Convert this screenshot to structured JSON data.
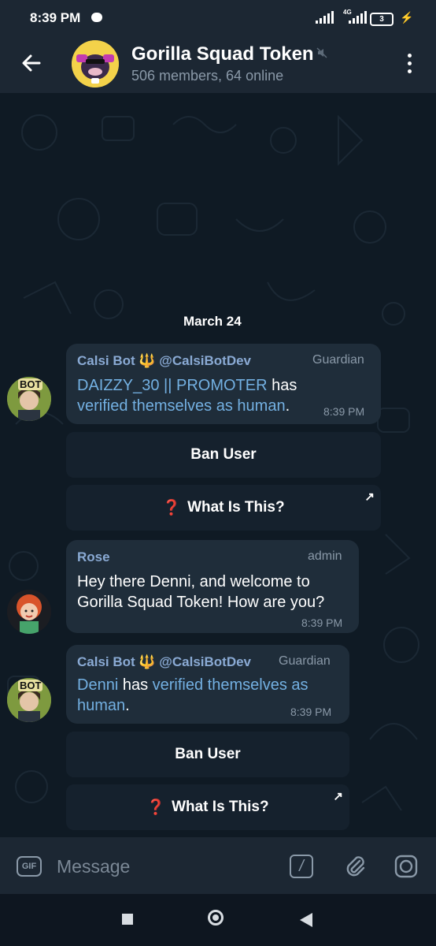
{
  "status_bar": {
    "time": "8:39 PM",
    "network": "4G",
    "battery": "3"
  },
  "header": {
    "title": "Gorilla Squad Token",
    "subtitle": "506 members, 64 online"
  },
  "date_separator": "March 24",
  "messages": [
    {
      "sender": "Calsi Bot 🔱 @CalsiBotDev",
      "tag": "Guardian",
      "user_link": "DAIZZY_30 || PROMOTER",
      "word_has": "has",
      "verified_text": "verified themselves as human",
      "period": ".",
      "time": "8:39 PM",
      "avatar_label": "BOT",
      "buttons": {
        "ban": "Ban User",
        "what_icon": "❓",
        "what": "What Is This?",
        "arrow": "↗"
      }
    },
    {
      "sender": "Rose",
      "tag": "admin",
      "text_line1": "Hey there Denni, and welcome to",
      "text_line2": "Gorilla Squad Token! How are you?",
      "time": "8:39 PM"
    },
    {
      "sender": "Calsi Bot 🔱 @CalsiBotDev",
      "tag": "Guardian",
      "user_link": "Denni",
      "word_has": "has",
      "verified_text_1": "verified themselves as",
      "verified_text_2": "human",
      "period": ".",
      "time": "8:39 PM",
      "avatar_label": "BOT",
      "buttons": {
        "ban": "Ban User",
        "what_icon": "❓",
        "what": "What Is This?",
        "arrow": "↗"
      }
    }
  ],
  "input_bar": {
    "gif_label": "GIF",
    "placeholder": "Message",
    "command_label": "/"
  },
  "colors": {
    "background": "#0f1a24",
    "bars": "#1c2733",
    "bubble": "#1f2d3a",
    "link": "#73b0e2",
    "sender": "#8aaad4"
  },
  "icons": [
    "back-arrow-icon",
    "mute-icon",
    "more-vertical-icon",
    "gif-icon",
    "slash-command-icon",
    "attach-icon",
    "camera-icon",
    "nav-square-icon",
    "nav-home-icon",
    "nav-back-icon"
  ]
}
